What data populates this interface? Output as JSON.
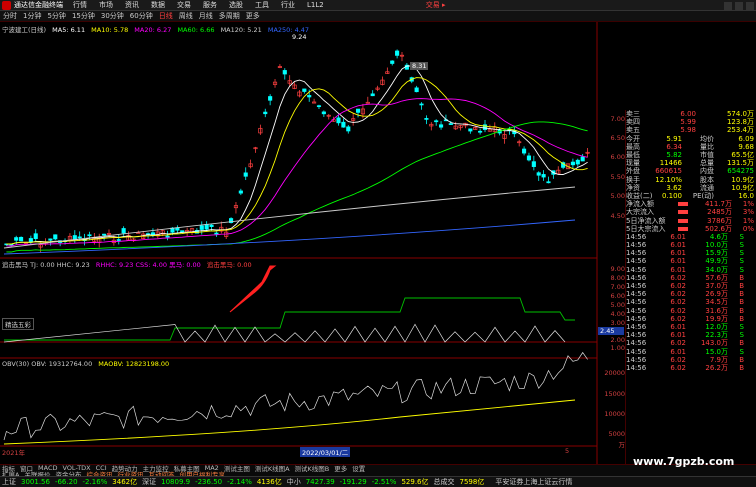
{
  "titlebar": {
    "app_name": "通达信金融终端",
    "menus": [
      "行情",
      "市场",
      "资讯",
      "数据",
      "交易",
      "服务",
      "选股",
      "工具",
      "行业",
      "L1L2"
    ],
    "trade_label": "交易 ▸"
  },
  "menubar": {
    "items": [
      "分时",
      "1分钟",
      "5分钟",
      "15分钟",
      "30分钟",
      "60分钟",
      "日线",
      "周线",
      "月线",
      "多周期",
      "更多"
    ],
    "active": "日线"
  },
  "main_chart": {
    "header_stock": "宁波建工(日线)",
    "ma_labels": [
      {
        "text": "MA5: 6.11",
        "color": "#ffffff"
      },
      {
        "text": "MA10: 5.78",
        "color": "#ffff00"
      },
      {
        "text": "MA20: 6.27",
        "color": "#ff00ff"
      },
      {
        "text": "MA60: 6.66",
        "color": "#00ff00"
      },
      {
        "text": "MA120: 5.21",
        "color": "#cccccc"
      },
      {
        "text": "MA250: 4.47",
        "color": "#3366ff"
      }
    ],
    "high_label": "9.24",
    "mid_label": "8.31",
    "y_ticks": [
      "7.00",
      "6.50",
      "6.00",
      "5.50",
      "5.00",
      "4.50"
    ]
  },
  "indicator1": {
    "label": "追击黑马 TJ: 0.00  HHC: 9.23",
    "label2": "RHHC: 9.23  CSS: 4.00  黑马: 0.00",
    "label3": "追击黑马: 0.00",
    "y_ticks": [
      "9.00",
      "8.00",
      "7.00",
      "6.00",
      "5.00",
      "4.00",
      "3.00",
      "2.00",
      "1.00"
    ],
    "badge": "2.45",
    "sub_label": "精选五彩"
  },
  "indicator2": {
    "label": "OBV(30) OBV: 19312764.00",
    "label2": "MAOBV: 12823198.00",
    "y_ticks": [
      "20000",
      "15000",
      "10000",
      "5000",
      "万"
    ]
  },
  "xaxis": {
    "left": "2021年",
    "mid": "2022/03/01/二",
    "tick": "5"
  },
  "quote_panel": {
    "book": [
      {
        "k": "卖三",
        "p": "6.00",
        "v": "574.0万"
      },
      {
        "k": "卖四",
        "p": "5.99",
        "v": "123.8万"
      },
      {
        "k": "卖五",
        "p": "5.98",
        "v": "253.4万"
      }
    ],
    "stats": [
      {
        "k1": "今开",
        "v1": "5.91",
        "k2": "均价",
        "v2": "6.09"
      },
      {
        "k1": "最高",
        "v1": "6.34",
        "k2": "量比",
        "v2": "9.68"
      },
      {
        "k1": "最低",
        "v1": "5.82",
        "k2": "市值",
        "v2": "65.5亿"
      },
      {
        "k1": "现量",
        "v1": "11466",
        "k2": "总量",
        "v2": "131.5万"
      },
      {
        "k1": "外盘",
        "v1": "660615",
        "k2": "内盘",
        "v2": "654275"
      },
      {
        "k1": "换手",
        "v1": "12.10%",
        "k2": "股本",
        "v2": "10.9亿"
      },
      {
        "k1": "净资",
        "v1": "3.62",
        "k2": "流通",
        "v2": "10.9亿"
      },
      {
        "k1": "收益(二)",
        "v1": "0.100",
        "k2": "PE(动)",
        "v2": "16.0"
      }
    ],
    "flows": [
      {
        "k": "净流入额",
        "v": "411.7万",
        "p": "1%"
      },
      {
        "k": "大宗流入",
        "v": "2485万",
        "p": "3%"
      },
      {
        "k": "5日净流入额",
        "v": "3786万",
        "p": "1%"
      },
      {
        "k": "5日大宗流入",
        "v": "502.6万",
        "p": "0%"
      }
    ],
    "ticks": [
      {
        "t": "14:56",
        "p": "6.01",
        "v": "4.6万",
        "f": "S",
        "c": "#00ff00"
      },
      {
        "t": "14:56",
        "p": "6.01",
        "v": "10.0万",
        "f": "S",
        "c": "#00ff00"
      },
      {
        "t": "14:56",
        "p": "6.01",
        "v": "15.9万",
        "f": "S",
        "c": "#00ff00"
      },
      {
        "t": "14:56",
        "p": "6.01",
        "v": "49.9万",
        "f": "S",
        "c": "#00ff00"
      },
      {
        "t": "14:56",
        "p": "6.01",
        "v": "34.0万",
        "f": "S",
        "c": "#00ff00"
      },
      {
        "t": "14:56",
        "p": "6.02",
        "v": "57.6万",
        "f": "B",
        "c": "#ff4040"
      },
      {
        "t": "14:56",
        "p": "6.02",
        "v": "37.0万",
        "f": "B",
        "c": "#ff4040"
      },
      {
        "t": "14:56",
        "p": "6.02",
        "v": "26.9万",
        "f": "B",
        "c": "#ff4040"
      },
      {
        "t": "14:56",
        "p": "6.02",
        "v": "34.5万",
        "f": "B",
        "c": "#ff4040"
      },
      {
        "t": "14:56",
        "p": "6.02",
        "v": "31.6万",
        "f": "B",
        "c": "#ff4040"
      },
      {
        "t": "14:56",
        "p": "6.02",
        "v": "19.9万",
        "f": "B",
        "c": "#ff4040"
      },
      {
        "t": "14:56",
        "p": "6.01",
        "v": "12.0万",
        "f": "S",
        "c": "#00ff00"
      },
      {
        "t": "14:56",
        "p": "6.01",
        "v": "22.3万",
        "f": "S",
        "c": "#00ff00"
      },
      {
        "t": "14:56",
        "p": "6.02",
        "v": "143.0万",
        "f": "B",
        "c": "#ff4040"
      },
      {
        "t": "14:56",
        "p": "6.01",
        "v": "15.0万",
        "f": "S",
        "c": "#00ff00"
      },
      {
        "t": "14:56",
        "p": "6.02",
        "v": "7.9万",
        "f": "B",
        "c": "#ff4040"
      },
      {
        "t": "14:56",
        "p": "6.02",
        "v": "26.2万",
        "f": "B",
        "c": "#ff4040"
      }
    ]
  },
  "bottom_tabs": [
    "指标",
    "窗口",
    "MACD",
    "VOL-TDX",
    "CCI",
    "趋势动力",
    "主力监控",
    "私募主图",
    "MA2",
    "测试主图",
    "测试K线图A",
    "测试K线图B",
    "更多",
    "设置"
  ],
  "bottom_tabs2": [
    "扩展A",
    "关联报价",
    "资金分布",
    "综合资讯",
    "行业资讯",
    "互动问答",
    "创用户福利专享"
  ],
  "status": [
    {
      "name": "上证",
      "val": "3001.56",
      "chg": "-66.20",
      "pct": "-2.16%",
      "amt": "3462亿"
    },
    {
      "name": "深证",
      "val": "10809.9",
      "chg": "-236.50",
      "pct": "-2.14%",
      "amt": "4136亿"
    },
    {
      "name": "中小",
      "val": "7427.39",
      "chg": "-191.29",
      "pct": "-2.51%",
      "amt": "529.6亿"
    }
  ],
  "status_total": {
    "label": "总成交",
    "amt": "7598亿"
  },
  "status_right": "平安证券上海上证云行情",
  "watermark": "www.7gpzb.com"
}
